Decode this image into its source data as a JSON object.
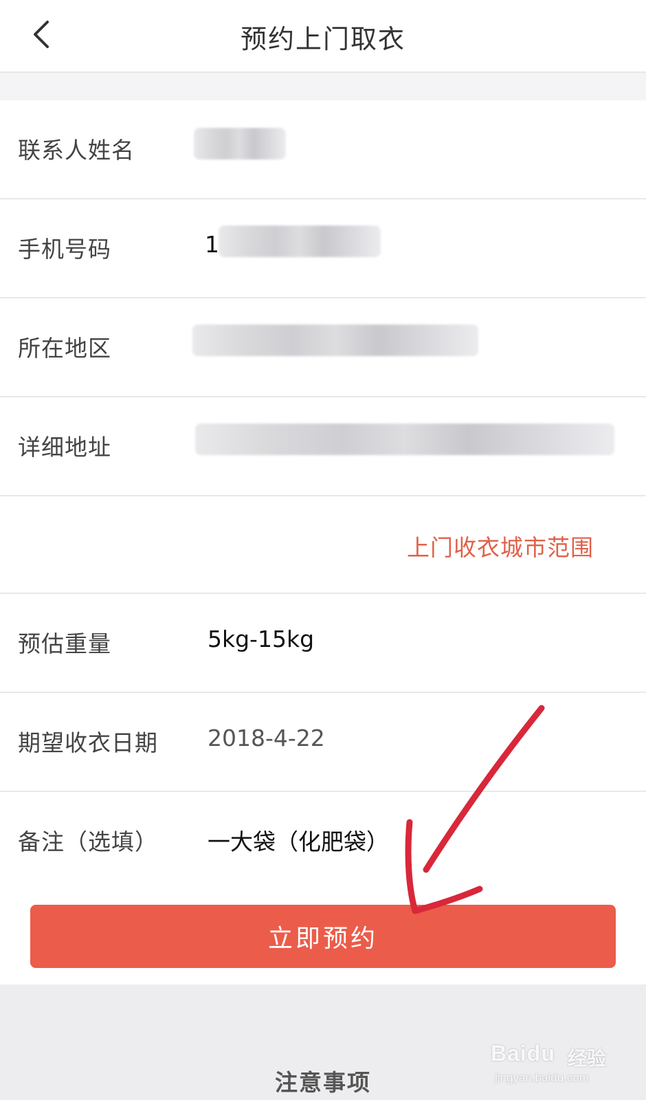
{
  "header": {
    "title": "预约上门取衣"
  },
  "form": {
    "contact_name": {
      "label": "联系人姓名"
    },
    "phone": {
      "label": "手机号码",
      "value_prefix": "1"
    },
    "region": {
      "label": "所在地区"
    },
    "address": {
      "label": "详细地址"
    },
    "city_range_link": "上门收衣城市范围",
    "weight": {
      "label": "预估重量",
      "value": "5kg-15kg"
    },
    "date": {
      "label": "期望收衣日期",
      "value": "2018-4-22"
    },
    "remark": {
      "label": "备注（选填）",
      "value": "一大袋（化肥袋）"
    }
  },
  "submit_label": "立即预约",
  "footer": {
    "notice_title": "注意事项"
  },
  "watermark": {
    "brand": "Baidu",
    "brand_cn": "经验",
    "url": "jingyan.baidu.com"
  },
  "icons": {
    "back": "chevron-left-icon",
    "annotation": "red-arrow-annotation"
  },
  "colors": {
    "accent": "#ec5c4a",
    "link": "#e0614a",
    "annotation": "#d8283a"
  }
}
